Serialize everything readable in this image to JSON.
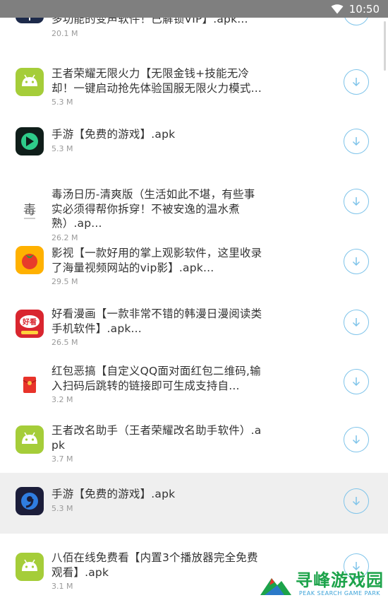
{
  "status_bar": {
    "time": "10:50",
    "bg_color": "#7f7f7f"
  },
  "accent_color": "#7fc4ea",
  "download_icon": "download-arrow-icon",
  "apps": [
    {
      "title": "多功能的变声软件！已解锁VIP】.apk...",
      "size": "20.1 M",
      "icon": "voice-changer-icon"
    },
    {
      "title": "王者荣耀无限火力【无限金钱+技能无冷却！一键启动抢先体验国服无限火力模式...",
      "size": "5.3 M",
      "icon": "android-icon"
    },
    {
      "title": "手游【免费的游戏】.apk",
      "size": "5.3 M",
      "icon": "game-circle-icon"
    },
    {
      "title": "毒汤日历-清爽版（生活如此不堪，有些事实必须得帮你拆穿！不被安逸的温水煮熟）.ap...",
      "size": "26.2 M",
      "icon": "calendar-icon"
    },
    {
      "title": "影视【一款好用的掌上观影软件，这里收录了海量视频网站的vip影】.apk...",
      "size": "29.5 M",
      "icon": "tomato-video-icon"
    },
    {
      "title": "好看漫画【一款非常不错的韩漫日漫阅读类手机软件】.apk...",
      "size": "26.5 M",
      "icon": "comic-icon"
    },
    {
      "title": "红包恶搞【自定义QQ面对面红包二维码,输入扫码后跳转的链接即可生成支持自...",
      "size": "3.2 M",
      "icon": "red-envelope-icon"
    },
    {
      "title": "王者改名助手（王者荣耀改名助手软件）.apk",
      "size": "3.7 M",
      "icon": "android-icon"
    },
    {
      "title": "手游【免费的游戏】.apk",
      "size": "5.3 M",
      "icon": "blue-nine-icon"
    },
    {
      "title": "八佰在线免费看【内置3个播放器完全免费观看】.apk",
      "size": "3.1 M",
      "icon": "android-icon"
    }
  ],
  "watermark": {
    "name": "寻峰游戏园",
    "sub": "PEAK SEARCH GAME PARK",
    "color": "#1ca34a"
  }
}
